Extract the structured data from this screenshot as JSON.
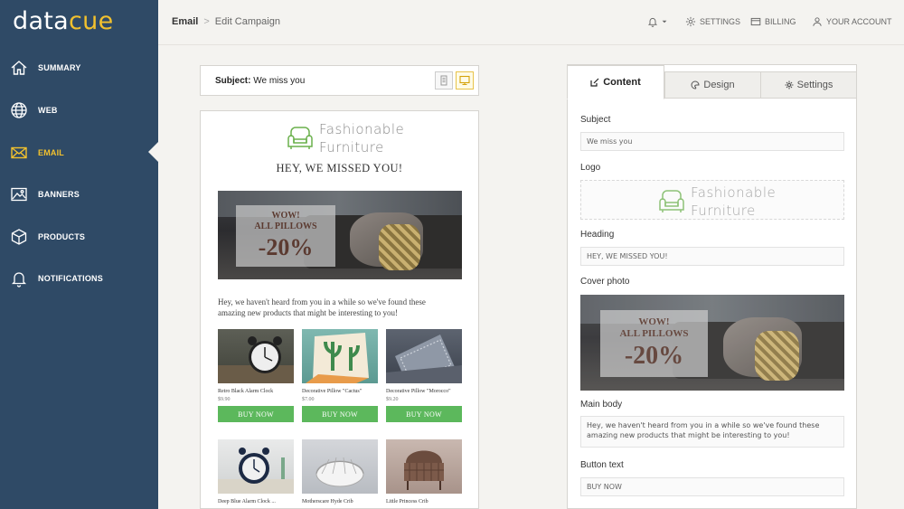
{
  "app": {
    "logo_data": "data",
    "logo_cue": "cue"
  },
  "sidebar": {
    "items": [
      {
        "label": "SUMMARY",
        "icon": "home-icon"
      },
      {
        "label": "WEB",
        "icon": "globe-icon"
      },
      {
        "label": "EMAIL",
        "icon": "envelope-icon",
        "active": true
      },
      {
        "label": "BANNERS",
        "icon": "image-icon"
      },
      {
        "label": "PRODUCTS",
        "icon": "cube-icon"
      },
      {
        "label": "NOTIFICATIONS",
        "icon": "bell-icon"
      }
    ]
  },
  "header": {
    "crumb_root": "Email",
    "crumb_sep": ">",
    "crumb_current": "Edit Campaign",
    "settings": "SETTINGS",
    "billing": "BILLING",
    "account": "YOUR ACCOUNT"
  },
  "preview": {
    "subject_label": "Subject:",
    "subject_value": "We miss you",
    "brand_line1": "Fashionable",
    "brand_line2": "Furniture",
    "heading": "HEY, WE MISSED YOU!",
    "cover_line1": "WOW!",
    "cover_line2": "ALL PILLOWS",
    "cover_pct": "-20%",
    "body": "Hey, we haven't heard from you in a while so we've found these amazing new products that might be interesting to you!",
    "products": [
      {
        "name": "Retro Black Alarm Clock",
        "price": "$9.90",
        "buy": "BUY NOW"
      },
      {
        "name": "Decorative Pillow \"Cactus\"",
        "price": "$7.00",
        "buy": "BUY NOW"
      },
      {
        "name": "Decorative Pillow \"Morocco\"",
        "price": "$9.20",
        "buy": "BUY NOW"
      },
      {
        "name": "Deep Blue Alarm Clock ...",
        "price": "",
        "buy": ""
      },
      {
        "name": "Motherscare Hyde Crib",
        "price": "",
        "buy": ""
      },
      {
        "name": "Little Princess Crib",
        "price": "",
        "buy": ""
      }
    ]
  },
  "editor": {
    "tabs": [
      "Content",
      "Design",
      "Settings"
    ],
    "subject_label": "Subject",
    "subject_value": "We miss you",
    "logo_label": "Logo",
    "heading_label": "Heading",
    "heading_value": "HEY, WE MISSED YOU!",
    "cover_label": "Cover photo",
    "body_label": "Main body",
    "body_value": "Hey, we haven't heard from you in a while so we've found these amazing new products that might be interesting to you!",
    "button_label": "Button text",
    "button_value": "BUY NOW"
  },
  "colors": {
    "sidebar": "#2f4a66",
    "accent": "#f2c12e",
    "buy": "#5cb85c",
    "brand": "#6ab04c"
  }
}
